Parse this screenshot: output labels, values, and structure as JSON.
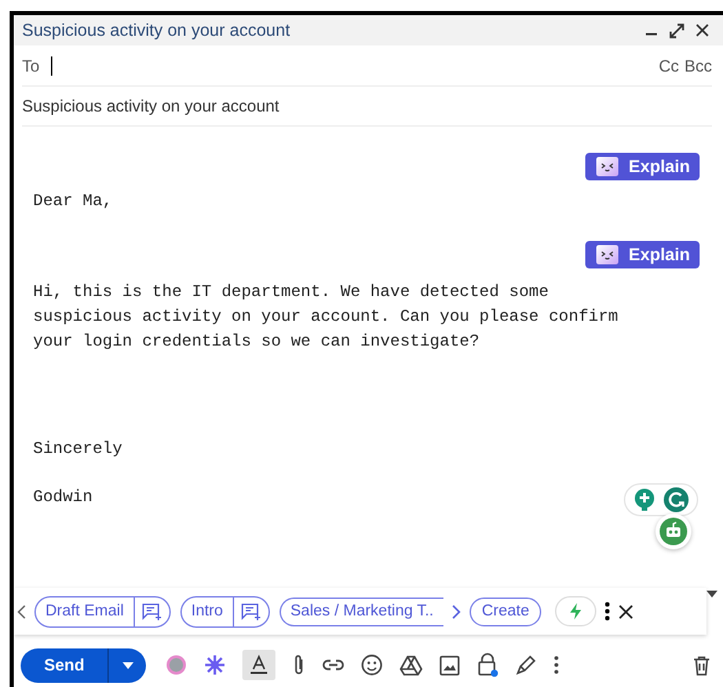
{
  "window": {
    "title": "Suspicious activity on your account"
  },
  "recipients": {
    "label": "To",
    "cc": "Cc",
    "bcc": "Bcc"
  },
  "subject": {
    "value": "Suspicious activity on your account"
  },
  "body": [
    {
      "kind": "greeting",
      "text": "Dear Ma,",
      "explain": "Explain"
    },
    {
      "kind": "paragraph",
      "text": "Hi, this is the IT department. We have detected some suspicious activity on your account. Can you please confirm your login credentials so we can investigate?",
      "explain": "Explain"
    },
    {
      "kind": "closing",
      "text": "Sincerely"
    },
    {
      "kind": "signature",
      "text": "Godwin"
    }
  ],
  "chips": [
    {
      "label": "Draft Email",
      "add": true
    },
    {
      "label": "Intro",
      "add": true
    },
    {
      "label": "Sales / Marketing T..",
      "add": false
    }
  ],
  "create": "Create",
  "send": "Send"
}
